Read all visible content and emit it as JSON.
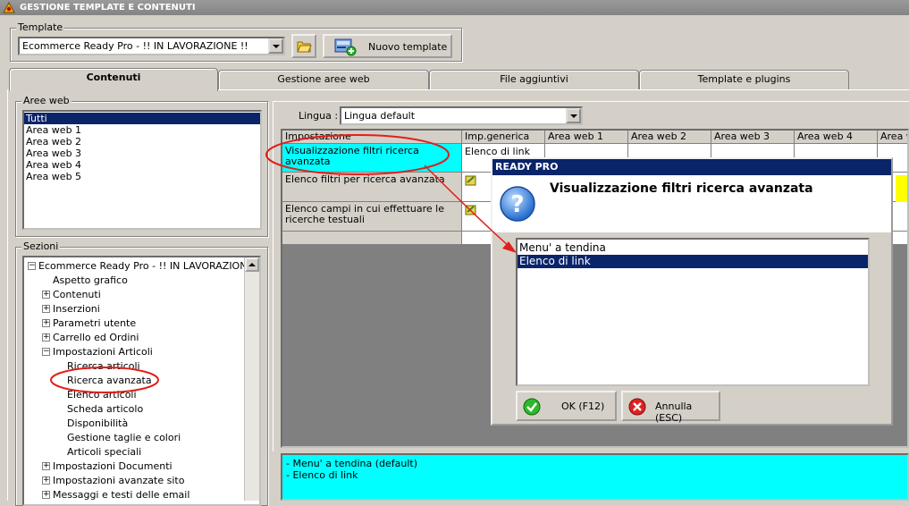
{
  "window": {
    "title": "GESTIONE TEMPLATE E CONTENUTI"
  },
  "template": {
    "legend": "Template",
    "selected": "Ecommerce Ready Pro - !! IN LAVORAZIONE !!",
    "new_button": "Nuovo template"
  },
  "tabs": [
    {
      "label": "Contenuti",
      "active": true
    },
    {
      "label": "Gestione aree web",
      "active": false
    },
    {
      "label": "File aggiuntivi",
      "active": false
    },
    {
      "label": "Template e plugins",
      "active": false
    }
  ],
  "aree_web": {
    "legend": "Aree web",
    "items": [
      "Tutti",
      "Area web 1",
      "Area web 2",
      "Area web 3",
      "Area web 4",
      "Area web 5"
    ],
    "selected_index": 0
  },
  "sezioni": {
    "legend": "Sezioni",
    "nodes": [
      {
        "label": "Ecommerce Ready Pro - !! IN LAVORAZIONE !!",
        "level": 0,
        "expander": "−"
      },
      {
        "label": "Aspetto grafico",
        "level": 1,
        "expander": ""
      },
      {
        "label": "Contenuti",
        "level": 1,
        "expander": "+"
      },
      {
        "label": "Inserzioni",
        "level": 1,
        "expander": "+"
      },
      {
        "label": "Parametri utente",
        "level": 1,
        "expander": "+"
      },
      {
        "label": "Carrello ed Ordini",
        "level": 1,
        "expander": "+"
      },
      {
        "label": "Impostazioni Articoli",
        "level": 1,
        "expander": "−"
      },
      {
        "label": "Ricerca articoli",
        "level": 2,
        "expander": ""
      },
      {
        "label": "Ricerca avanzata",
        "level": 2,
        "expander": ""
      },
      {
        "label": "Elenco articoli",
        "level": 2,
        "expander": ""
      },
      {
        "label": "Scheda articolo",
        "level": 2,
        "expander": ""
      },
      {
        "label": "Disponibilità",
        "level": 2,
        "expander": ""
      },
      {
        "label": "Gestione taglie e colori",
        "level": 2,
        "expander": ""
      },
      {
        "label": "Articoli speciali",
        "level": 2,
        "expander": ""
      },
      {
        "label": "Impostazioni Documenti",
        "level": 1,
        "expander": "+"
      },
      {
        "label": "Impostazioni avanzate sito",
        "level": 1,
        "expander": "+"
      },
      {
        "label": "Messaggi e testi delle email",
        "level": 1,
        "expander": "+"
      }
    ]
  },
  "lingua": {
    "label": "Lingua :",
    "selected": "Lingua default"
  },
  "grid": {
    "headers": [
      "Impostazione",
      "Imp.generica",
      "Area web 1",
      "Area web 2",
      "Area web 3",
      "Area web 4",
      "Area w"
    ],
    "rows": [
      {
        "setting": "Visualizzazione filtri ricerca avanzata",
        "generic": "Elenco di link",
        "highlight": true
      },
      {
        "setting": "Elenco filtri per ricerca avanzata",
        "generic": "",
        "highlight": false
      },
      {
        "setting": "Elenco campi in cui effettuare le ricerche testuali",
        "generic": "",
        "highlight": false
      }
    ]
  },
  "dialog": {
    "title": "READY PRO",
    "heading": "Visualizzazione filtri ricerca avanzata",
    "options": [
      "Menu' a tendina",
      "Elenco di link"
    ],
    "selected_index": 1,
    "ok_label": "OK (F12)",
    "cancel_label": "Annulla (ESC)"
  },
  "description": {
    "lines": [
      "- Menu' a tendina (default)",
      "- Elenco di link"
    ]
  },
  "colors": {
    "selection": "#0a246a",
    "cyan": "#00ffff",
    "annotation": "#e0201a"
  }
}
